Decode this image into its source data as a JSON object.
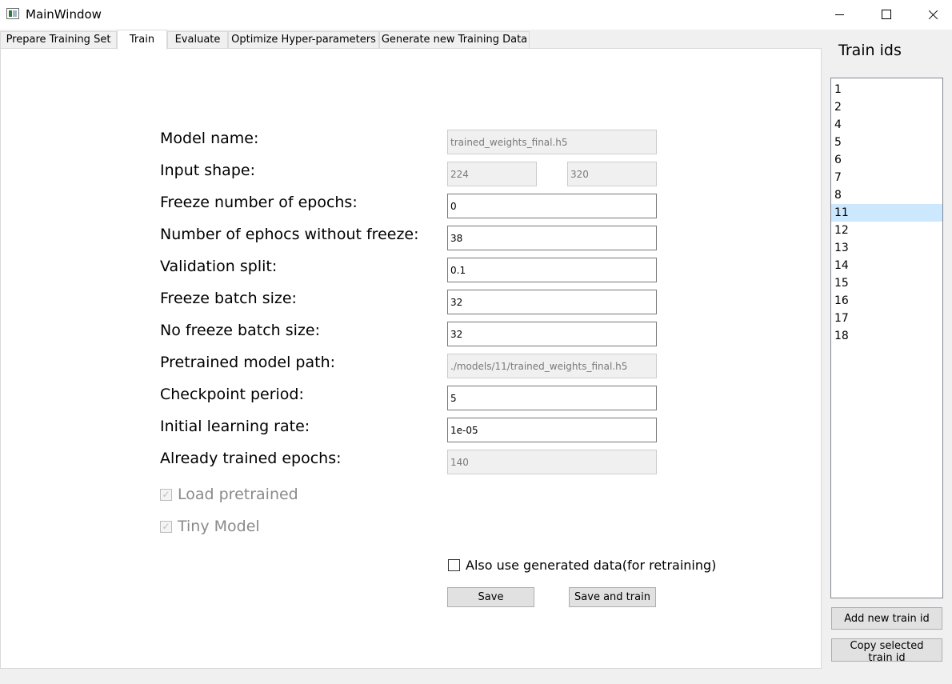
{
  "window": {
    "title": "MainWindow",
    "icon": "app-window-icon"
  },
  "tabs": [
    {
      "label": "Prepare Training Set",
      "active": false
    },
    {
      "label": "Train",
      "active": true
    },
    {
      "label": "Evaluate",
      "active": false
    },
    {
      "label": "Optimize Hyper-parameters",
      "active": false
    },
    {
      "label": "Generate new Training Data",
      "active": false
    }
  ],
  "form": {
    "model_name": {
      "label": "Model name:",
      "value": "trained_weights_final.h5",
      "enabled": false
    },
    "input_shape": {
      "label": "Input shape:",
      "width": "224",
      "height": "320",
      "enabled": false
    },
    "freeze_epochs": {
      "label": "Freeze number of epochs:",
      "value": "0"
    },
    "epochs_no_freeze": {
      "label": "Number of ephocs without freeze:",
      "value": "38"
    },
    "validation_split": {
      "label": "Validation split:",
      "value": "0.1"
    },
    "freeze_batch": {
      "label": "Freeze batch size:",
      "value": "32"
    },
    "no_freeze_batch": {
      "label": "No freeze batch size:",
      "value": "32"
    },
    "pretrained_path": {
      "label": "Pretrained model path:",
      "value": "./models/11/trained_weights_final.h5",
      "enabled": false
    },
    "checkpoint_period": {
      "label": "Checkpoint period:",
      "value": "5"
    },
    "learning_rate": {
      "label": "Initial learning rate:",
      "value": "1e-05"
    },
    "trained_epochs": {
      "label": "Already trained epochs:",
      "value": "140",
      "enabled": false
    },
    "load_pretrained": {
      "label": "Load pretrained",
      "checked": true,
      "enabled": false
    },
    "tiny_model": {
      "label": "Tiny Model",
      "checked": true,
      "enabled": false
    },
    "use_generated": {
      "label": "Also use generated data(for retraining)",
      "checked": false,
      "enabled": true
    },
    "save_label": "Save",
    "save_train_label": "Save and train"
  },
  "train_ids": {
    "title": "Train ids",
    "items": [
      "1",
      "2",
      "4",
      "5",
      "6",
      "7",
      "8",
      "11",
      "12",
      "13",
      "14",
      "15",
      "16",
      "17",
      "18"
    ],
    "selected": "11",
    "add_label": "Add new train id",
    "copy_label": "Copy selected train id"
  },
  "colors": {
    "selection": "#cce8ff",
    "button": "#e1e1e1",
    "window_bg": "#f0f0f0"
  }
}
